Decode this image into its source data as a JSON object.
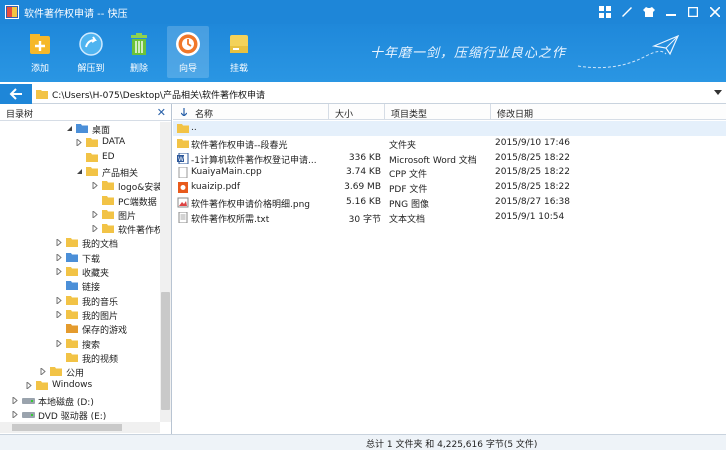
{
  "titlebar": {
    "title": "软件著作权申请 -- 快压"
  },
  "toolbar": {
    "buttons": [
      {
        "label": "添加",
        "icon": "add-icon"
      },
      {
        "label": "解压到",
        "icon": "extract-icon"
      },
      {
        "label": "删除",
        "icon": "trash-icon"
      },
      {
        "label": "向导",
        "icon": "wizard-icon"
      },
      {
        "label": "挂载",
        "icon": "mount-icon"
      }
    ],
    "slogan": "十年磨一剑，压缩行业良心之作"
  },
  "address": {
    "path": "C:\\Users\\H-075\\Desktop\\产品相关\\软件著作权申请"
  },
  "tree": {
    "header": "目录树",
    "items": [
      {
        "label": "桌面",
        "icon": "folder-blue-icon"
      },
      {
        "label": "DATA",
        "icon": "folder-icon"
      },
      {
        "label": "ED",
        "icon": "folder-icon"
      },
      {
        "label": "产品相关",
        "icon": "folder-icon"
      },
      {
        "label": "logo&安装",
        "icon": "folder-icon"
      },
      {
        "label": "PC端数据",
        "icon": "folder-icon"
      },
      {
        "label": "图片",
        "icon": "folder-icon"
      },
      {
        "label": "软件著作权",
        "icon": "folder-icon"
      },
      {
        "label": "我的文档",
        "icon": "documents-icon"
      },
      {
        "label": "下载",
        "icon": "download-icon"
      },
      {
        "label": "收藏夹",
        "icon": "favorites-icon"
      },
      {
        "label": "链接",
        "icon": "links-icon"
      },
      {
        "label": "我的音乐",
        "icon": "music-icon"
      },
      {
        "label": "我的图片",
        "icon": "pictures-icon"
      },
      {
        "label": "保存的游戏",
        "icon": "games-icon"
      },
      {
        "label": "搜索",
        "icon": "search-icon"
      },
      {
        "label": "我的视频",
        "icon": "videos-icon"
      },
      {
        "label": "公用",
        "icon": "folder-icon"
      },
      {
        "label": "Windows",
        "icon": "folder-icon"
      },
      {
        "label": "本地磁盘 (D:)",
        "icon": "drive-icon"
      },
      {
        "label": "DVD 驱动器 (E:)",
        "icon": "dvd-drive-icon"
      }
    ]
  },
  "files": {
    "columns": [
      "名称",
      "大小",
      "项目类型",
      "修改日期"
    ],
    "rows": [
      {
        "name": "..",
        "size": "",
        "type": "",
        "date": "",
        "icon": "folder-up-icon"
      },
      {
        "name": "软件著作权申请--段春光",
        "size": "",
        "type": "文件夹",
        "date": "2015/9/10 17:46",
        "icon": "folder-icon"
      },
      {
        "name": "-1计算机软件著作权登记申请...",
        "size": "336 KB",
        "type": "Microsoft Word 文档",
        "date": "2015/8/25 18:22",
        "icon": "word-icon"
      },
      {
        "name": "KuaiyaMain.cpp",
        "size": "3.74 KB",
        "type": "CPP 文件",
        "date": "2015/8/25 18:22",
        "icon": "file-icon"
      },
      {
        "name": "kuaizip.pdf",
        "size": "3.69 MB",
        "type": "PDF 文件",
        "date": "2015/8/25 18:22",
        "icon": "pdf-icon"
      },
      {
        "name": "软件著作权申请价格明细.png",
        "size": "5.16 KB",
        "type": "PNG 图像",
        "date": "2015/8/27 16:38",
        "icon": "image-icon"
      },
      {
        "name": "软件著作权所需.txt",
        "size": "30 字节",
        "type": "文本文档",
        "date": "2015/9/1 10:54",
        "icon": "text-file-icon"
      }
    ]
  },
  "status": {
    "text": "总计 1 文件夹 和 4,225,616 字节(5 文件)"
  }
}
